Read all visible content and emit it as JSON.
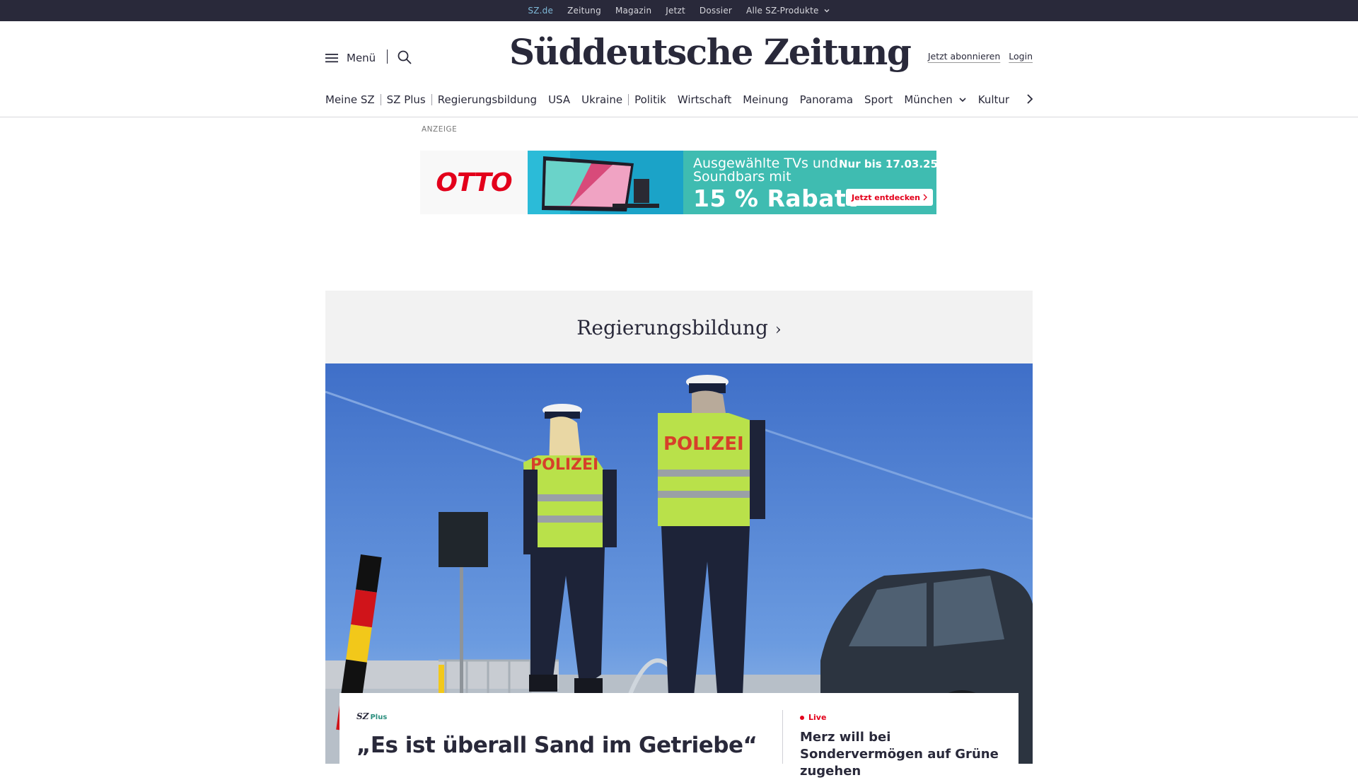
{
  "topbar": {
    "items": [
      "SZ.de",
      "Zeitung",
      "Magazin",
      "Jetzt",
      "Dossier",
      "Alle SZ-Produkte"
    ]
  },
  "header": {
    "menu_label": "Menü",
    "logo": "Süddeutsche Zeitung",
    "subscribe": "Jetzt abonnieren",
    "login": "Login"
  },
  "nav": {
    "items": [
      "Meine SZ",
      "SZ Plus",
      "Regierungsbildung",
      "USA",
      "Ukraine",
      "Politik",
      "Wirtschaft",
      "Meinung",
      "Panorama",
      "Sport",
      "München",
      "Kultur"
    ]
  },
  "ad": {
    "label": "ANZEIGE",
    "brand": "OTTO",
    "copy_line1": "Ausgewählte TVs und Soundbars mit",
    "copy_line2": "15 % Rabatt",
    "date": "Nur bis 17.03.25",
    "cta": "Jetzt entdecken"
  },
  "topic": {
    "title": "Regierungsbildung"
  },
  "teaser": {
    "badge_sz": "SZ",
    "badge_plus": "Plus",
    "headline": "„Es ist überall Sand im Getriebe“",
    "side_label": "Live",
    "side_headline": "Merz will bei Sondervermögen auf Grüne zugehen"
  },
  "hero": {
    "vest_text": "POLIZEI"
  },
  "colors": {
    "topbar_bg": "#29293a",
    "active_link": "#7fb9d8",
    "ad_red": "#e3001b",
    "ad_teal": "#3fbcb1",
    "plus_green": "#2a8f7e",
    "topic_bg": "#f2f2f2"
  }
}
